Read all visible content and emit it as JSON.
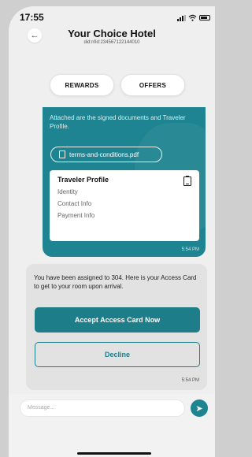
{
  "status_bar": {
    "time": "17:55"
  },
  "header": {
    "title": "Your Choice Hotel",
    "did": "did:nfid:234567122144010"
  },
  "tabs": {
    "rewards": "REWARDS",
    "offers": "OFFERS"
  },
  "teal_message": {
    "text": "Attached are the signed documents and Traveler Profile.",
    "attachment": "terms-and-conditions.pdf",
    "card": {
      "title": "Traveler Profile",
      "items": [
        "Identity",
        "Contact Info",
        "Payment Info"
      ]
    },
    "time": "5:54 PM"
  },
  "gray_message": {
    "text": "You have been assigned to 304. Here is your Access Card to get to your room upon arrival.",
    "accept_label": "Accept Access Card Now",
    "decline_label": "Decline",
    "time": "5:54 PM"
  },
  "composer": {
    "placeholder": "Message..."
  },
  "colors": {
    "teal": "#1e8491",
    "background": "#efefef"
  }
}
